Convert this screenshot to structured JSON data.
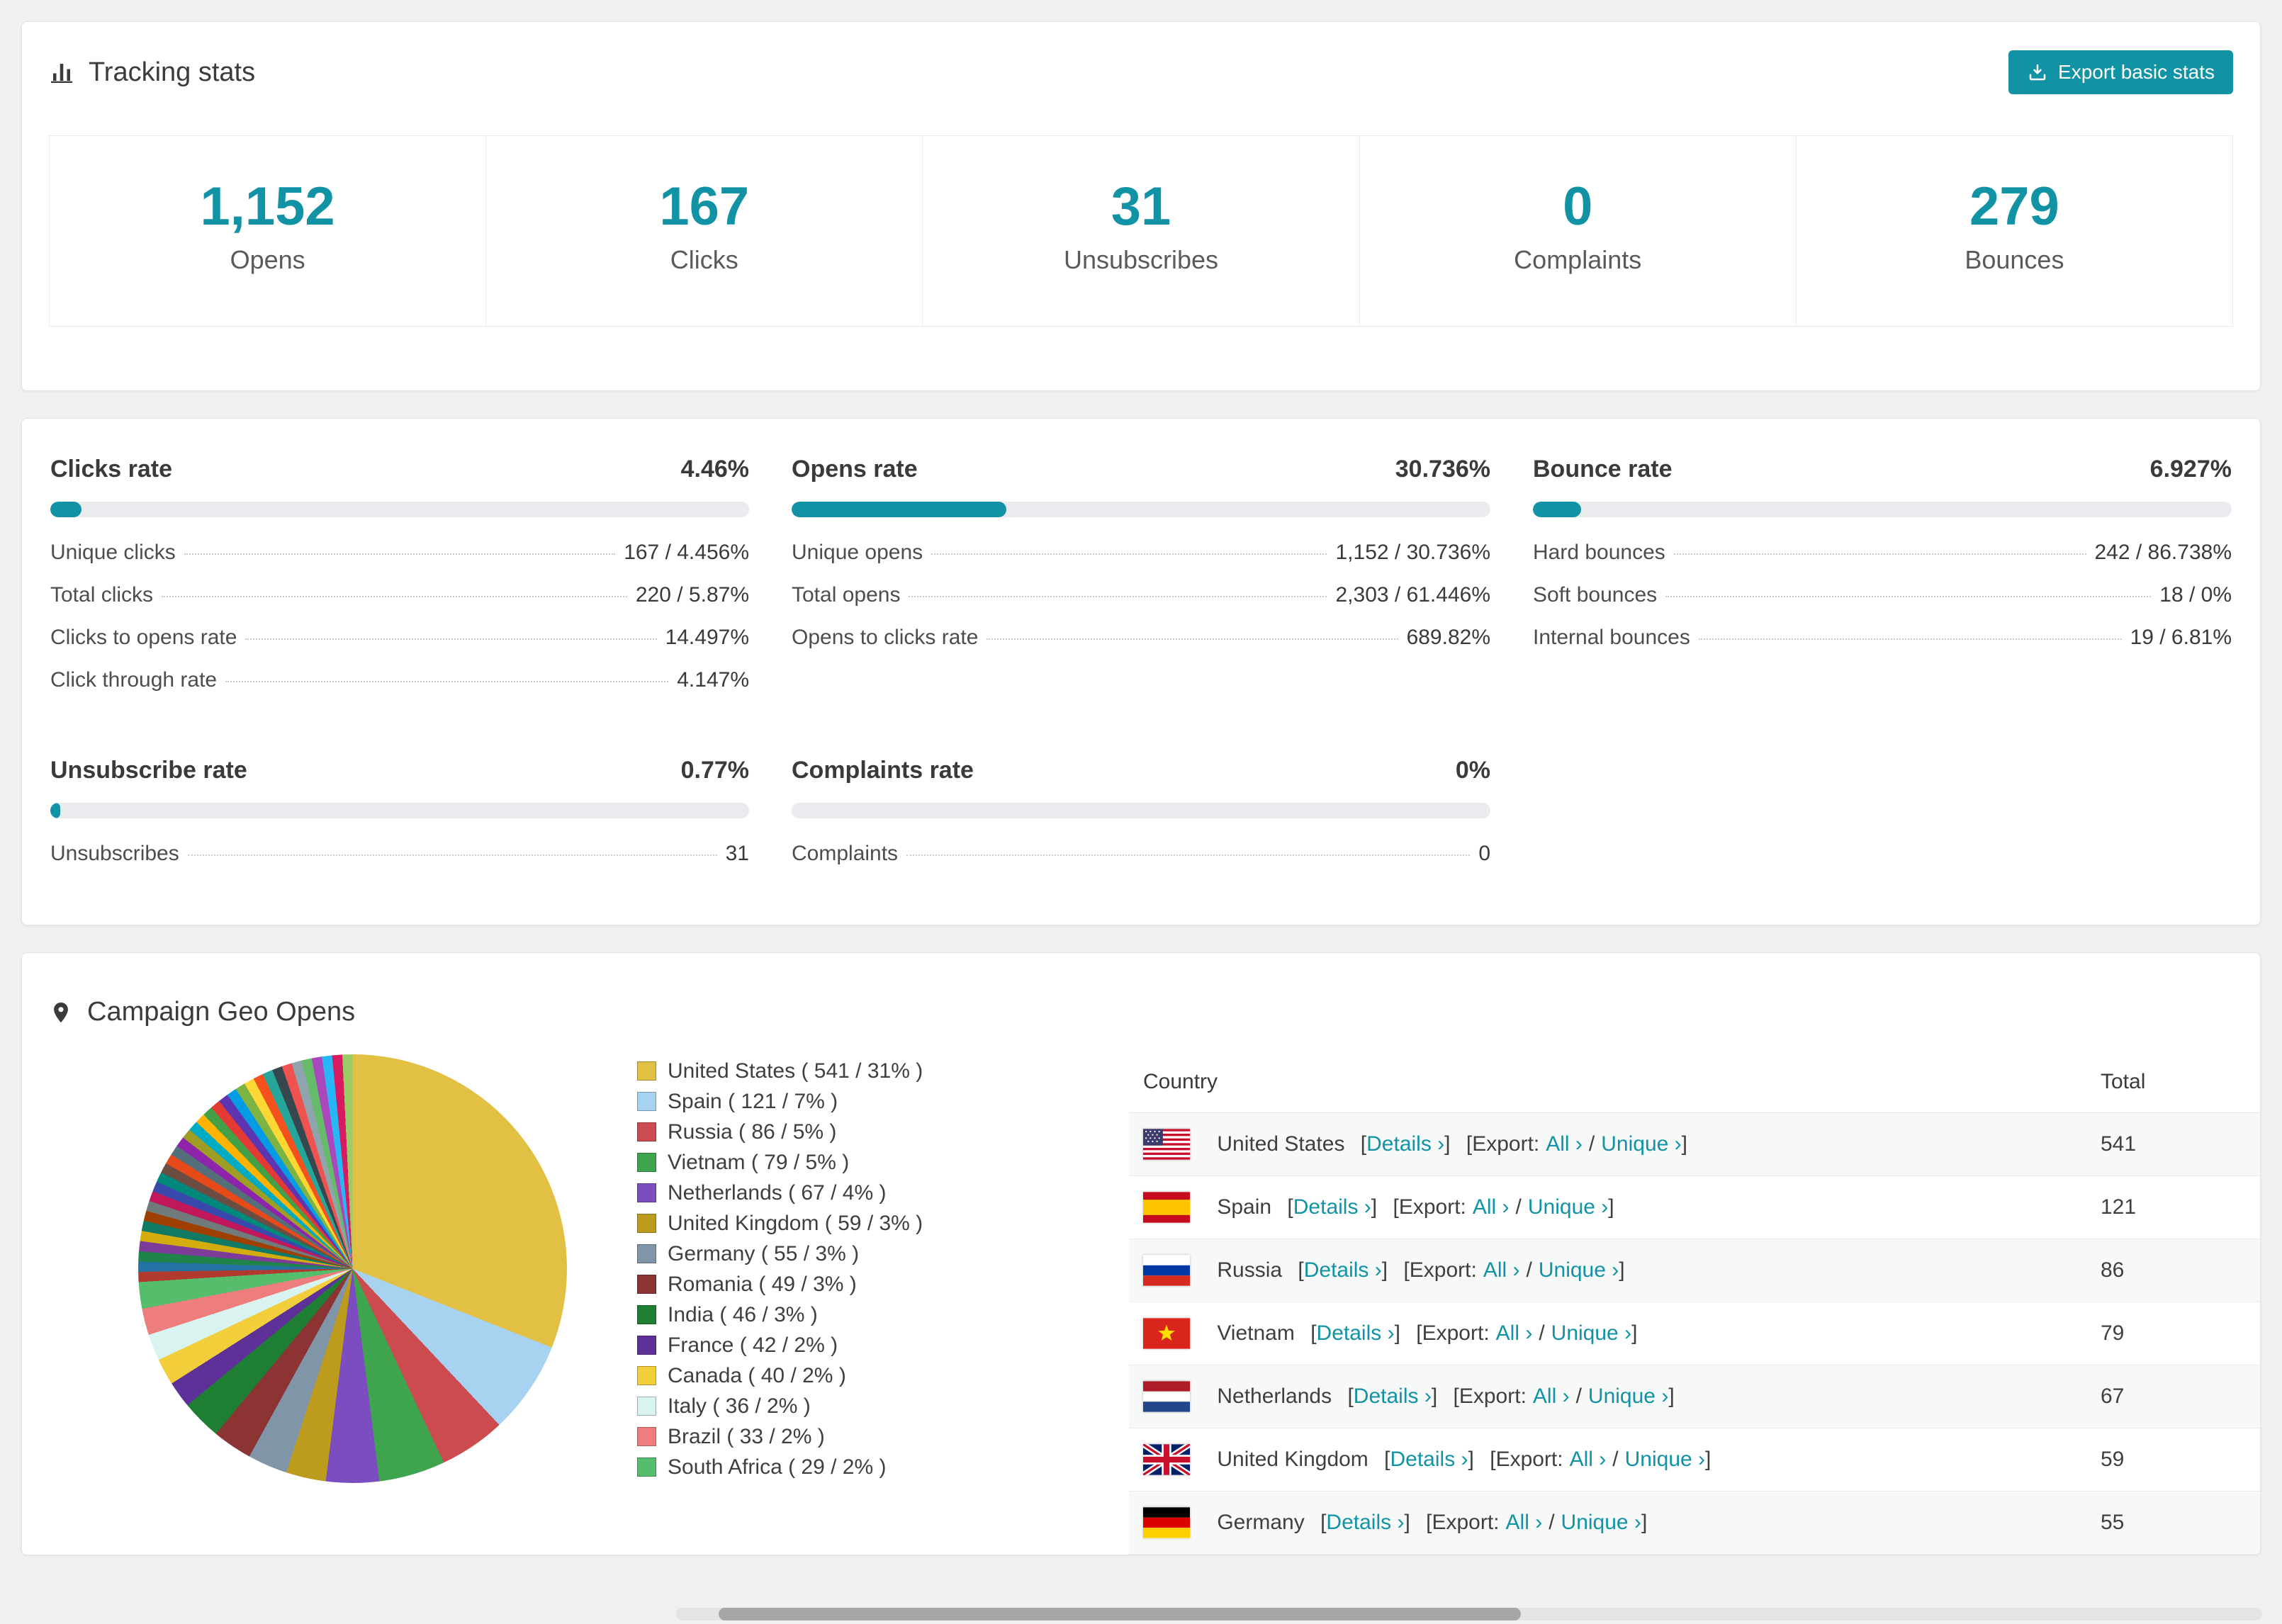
{
  "colors": {
    "accent": "#1193a5",
    "progress_track": "#e9ebee",
    "link": "#1193a5"
  },
  "tracking": {
    "title": "Tracking stats",
    "export_label": "Export basic stats",
    "stats": [
      {
        "value": "1,152",
        "label": "Opens"
      },
      {
        "value": "167",
        "label": "Clicks"
      },
      {
        "value": "31",
        "label": "Unsubscribes"
      },
      {
        "value": "0",
        "label": "Complaints"
      },
      {
        "value": "279",
        "label": "Bounces"
      }
    ]
  },
  "rates": [
    {
      "title": "Clicks rate",
      "value": "4.46%",
      "pct": 4.46,
      "rows": [
        {
          "label": "Unique clicks",
          "value": "167 / 4.456%"
        },
        {
          "label": "Total clicks",
          "value": "220 / 5.87%"
        },
        {
          "label": "Clicks to opens rate",
          "value": "14.497%"
        },
        {
          "label": "Click through rate",
          "value": "4.147%"
        }
      ]
    },
    {
      "title": "Opens rate",
      "value": "30.736%",
      "pct": 30.736,
      "rows": [
        {
          "label": "Unique opens",
          "value": "1,152 / 30.736%"
        },
        {
          "label": "Total opens",
          "value": "2,303 / 61.446%"
        },
        {
          "label": "Opens to clicks rate",
          "value": "689.82%"
        }
      ]
    },
    {
      "title": "Bounce rate",
      "value": "6.927%",
      "pct": 6.927,
      "rows": [
        {
          "label": "Hard bounces",
          "value": "242 / 86.738%"
        },
        {
          "label": "Soft bounces",
          "value": "18 / 0%"
        },
        {
          "label": "Internal bounces",
          "value": "19 / 6.81%"
        }
      ]
    },
    {
      "title": "Unsubscribe rate",
      "value": "0.77%",
      "pct": 0.77,
      "rows": [
        {
          "label": "Unsubscribes",
          "value": "31"
        }
      ]
    },
    {
      "title": "Complaints rate",
      "value": "0%",
      "pct": 0,
      "rows": [
        {
          "label": "Complaints",
          "value": "0"
        }
      ]
    }
  ],
  "geo": {
    "title": "Campaign Geo Opens",
    "table": {
      "col_country": "Country",
      "col_total": "Total",
      "labels": {
        "open": "[",
        "close": "]",
        "details": "Details ›",
        "export": "Export:",
        "all": "All ›",
        "slash": "/",
        "unique": "Unique ›"
      },
      "rows": [
        {
          "country": "United States",
          "total": "541",
          "flag": "us"
        },
        {
          "country": "Spain",
          "total": "121",
          "flag": "es"
        },
        {
          "country": "Russia",
          "total": "86",
          "flag": "ru"
        },
        {
          "country": "Vietnam",
          "total": "79",
          "flag": "vn"
        },
        {
          "country": "Netherlands",
          "total": "67",
          "flag": "nl"
        },
        {
          "country": "United Kingdom",
          "total": "59",
          "flag": "gb"
        },
        {
          "country": "Germany",
          "total": "55",
          "flag": "de"
        }
      ]
    }
  },
  "chart_data": {
    "type": "pie",
    "title": "Campaign Geo Opens",
    "legend_position": "right",
    "slices": [
      {
        "label": "United States",
        "value": 541,
        "pct": 31,
        "color": "#e2c044",
        "display": "United States ( 541 / 31% )"
      },
      {
        "label": "Spain",
        "value": 121,
        "pct": 7,
        "color": "#a8d3f0",
        "display": "Spain ( 121 / 7% )"
      },
      {
        "label": "Russia",
        "value": 86,
        "pct": 5,
        "color": "#cc4b4e",
        "display": "Russia ( 86 / 5% )"
      },
      {
        "label": "Vietnam",
        "value": 79,
        "pct": 5,
        "color": "#3fa44e",
        "display": "Vietnam ( 79 / 5% )"
      },
      {
        "label": "Netherlands",
        "value": 67,
        "pct": 4,
        "color": "#7c4dbe",
        "display": "Netherlands ( 67 / 4% )"
      },
      {
        "label": "United Kingdom",
        "value": 59,
        "pct": 3,
        "color": "#bd9b1c",
        "display": "United Kingdom ( 59 / 3% )"
      },
      {
        "label": "Germany",
        "value": 55,
        "pct": 3,
        "color": "#8095a8",
        "display": "Germany ( 55 / 3% )"
      },
      {
        "label": "Romania",
        "value": 49,
        "pct": 3,
        "color": "#8c3333",
        "display": "Romania ( 49 / 3% )"
      },
      {
        "label": "India",
        "value": 46,
        "pct": 3,
        "color": "#1e7e34",
        "display": "India ( 46 / 3% )"
      },
      {
        "label": "France",
        "value": 42,
        "pct": 2,
        "color": "#5e3199",
        "display": "France ( 42 / 2% )"
      },
      {
        "label": "Canada",
        "value": 40,
        "pct": 2,
        "color": "#f1ce3a",
        "display": "Canada ( 40 / 2% )"
      },
      {
        "label": "Italy",
        "value": 36,
        "pct": 2,
        "color": "#d9f3f1",
        "display": "Italy ( 36 / 2% )"
      },
      {
        "label": "Brazil",
        "value": 33,
        "pct": 2,
        "color": "#ee7d7d",
        "display": "Brazil ( 33 / 2% )"
      },
      {
        "label": "South Africa",
        "value": 29,
        "pct": 2,
        "color": "#55bd6b",
        "display": "South Africa ( 29 / 2% )"
      }
    ],
    "others_pct": 26
  }
}
